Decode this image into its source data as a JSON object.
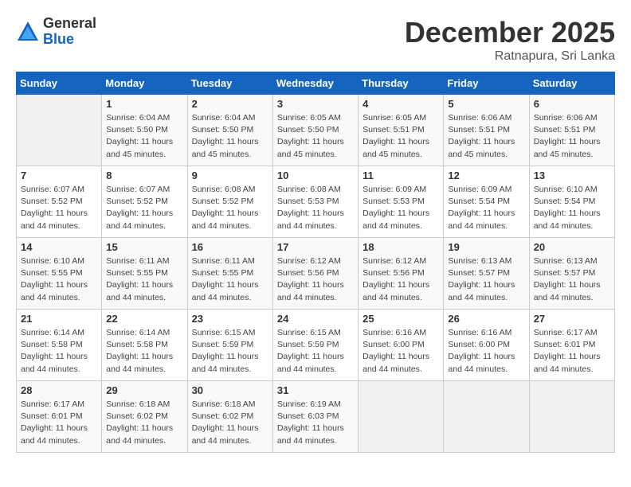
{
  "header": {
    "logo_general": "General",
    "logo_blue": "Blue",
    "title": "December 2025",
    "location": "Ratnapura, Sri Lanka"
  },
  "weekdays": [
    "Sunday",
    "Monday",
    "Tuesday",
    "Wednesday",
    "Thursday",
    "Friday",
    "Saturday"
  ],
  "weeks": [
    [
      {
        "day": "",
        "info": ""
      },
      {
        "day": "1",
        "info": "Sunrise: 6:04 AM\nSunset: 5:50 PM\nDaylight: 11 hours\nand 45 minutes."
      },
      {
        "day": "2",
        "info": "Sunrise: 6:04 AM\nSunset: 5:50 PM\nDaylight: 11 hours\nand 45 minutes."
      },
      {
        "day": "3",
        "info": "Sunrise: 6:05 AM\nSunset: 5:50 PM\nDaylight: 11 hours\nand 45 minutes."
      },
      {
        "day": "4",
        "info": "Sunrise: 6:05 AM\nSunset: 5:51 PM\nDaylight: 11 hours\nand 45 minutes."
      },
      {
        "day": "5",
        "info": "Sunrise: 6:06 AM\nSunset: 5:51 PM\nDaylight: 11 hours\nand 45 minutes."
      },
      {
        "day": "6",
        "info": "Sunrise: 6:06 AM\nSunset: 5:51 PM\nDaylight: 11 hours\nand 45 minutes."
      }
    ],
    [
      {
        "day": "7",
        "info": "Sunrise: 6:07 AM\nSunset: 5:52 PM\nDaylight: 11 hours\nand 44 minutes."
      },
      {
        "day": "8",
        "info": "Sunrise: 6:07 AM\nSunset: 5:52 PM\nDaylight: 11 hours\nand 44 minutes."
      },
      {
        "day": "9",
        "info": "Sunrise: 6:08 AM\nSunset: 5:52 PM\nDaylight: 11 hours\nand 44 minutes."
      },
      {
        "day": "10",
        "info": "Sunrise: 6:08 AM\nSunset: 5:53 PM\nDaylight: 11 hours\nand 44 minutes."
      },
      {
        "day": "11",
        "info": "Sunrise: 6:09 AM\nSunset: 5:53 PM\nDaylight: 11 hours\nand 44 minutes."
      },
      {
        "day": "12",
        "info": "Sunrise: 6:09 AM\nSunset: 5:54 PM\nDaylight: 11 hours\nand 44 minutes."
      },
      {
        "day": "13",
        "info": "Sunrise: 6:10 AM\nSunset: 5:54 PM\nDaylight: 11 hours\nand 44 minutes."
      }
    ],
    [
      {
        "day": "14",
        "info": "Sunrise: 6:10 AM\nSunset: 5:55 PM\nDaylight: 11 hours\nand 44 minutes."
      },
      {
        "day": "15",
        "info": "Sunrise: 6:11 AM\nSunset: 5:55 PM\nDaylight: 11 hours\nand 44 minutes."
      },
      {
        "day": "16",
        "info": "Sunrise: 6:11 AM\nSunset: 5:55 PM\nDaylight: 11 hours\nand 44 minutes."
      },
      {
        "day": "17",
        "info": "Sunrise: 6:12 AM\nSunset: 5:56 PM\nDaylight: 11 hours\nand 44 minutes."
      },
      {
        "day": "18",
        "info": "Sunrise: 6:12 AM\nSunset: 5:56 PM\nDaylight: 11 hours\nand 44 minutes."
      },
      {
        "day": "19",
        "info": "Sunrise: 6:13 AM\nSunset: 5:57 PM\nDaylight: 11 hours\nand 44 minutes."
      },
      {
        "day": "20",
        "info": "Sunrise: 6:13 AM\nSunset: 5:57 PM\nDaylight: 11 hours\nand 44 minutes."
      }
    ],
    [
      {
        "day": "21",
        "info": "Sunrise: 6:14 AM\nSunset: 5:58 PM\nDaylight: 11 hours\nand 44 minutes."
      },
      {
        "day": "22",
        "info": "Sunrise: 6:14 AM\nSunset: 5:58 PM\nDaylight: 11 hours\nand 44 minutes."
      },
      {
        "day": "23",
        "info": "Sunrise: 6:15 AM\nSunset: 5:59 PM\nDaylight: 11 hours\nand 44 minutes."
      },
      {
        "day": "24",
        "info": "Sunrise: 6:15 AM\nSunset: 5:59 PM\nDaylight: 11 hours\nand 44 minutes."
      },
      {
        "day": "25",
        "info": "Sunrise: 6:16 AM\nSunset: 6:00 PM\nDaylight: 11 hours\nand 44 minutes."
      },
      {
        "day": "26",
        "info": "Sunrise: 6:16 AM\nSunset: 6:00 PM\nDaylight: 11 hours\nand 44 minutes."
      },
      {
        "day": "27",
        "info": "Sunrise: 6:17 AM\nSunset: 6:01 PM\nDaylight: 11 hours\nand 44 minutes."
      }
    ],
    [
      {
        "day": "28",
        "info": "Sunrise: 6:17 AM\nSunset: 6:01 PM\nDaylight: 11 hours\nand 44 minutes."
      },
      {
        "day": "29",
        "info": "Sunrise: 6:18 AM\nSunset: 6:02 PM\nDaylight: 11 hours\nand 44 minutes."
      },
      {
        "day": "30",
        "info": "Sunrise: 6:18 AM\nSunset: 6:02 PM\nDaylight: 11 hours\nand 44 minutes."
      },
      {
        "day": "31",
        "info": "Sunrise: 6:19 AM\nSunset: 6:03 PM\nDaylight: 11 hours\nand 44 minutes."
      },
      {
        "day": "",
        "info": ""
      },
      {
        "day": "",
        "info": ""
      },
      {
        "day": "",
        "info": ""
      }
    ]
  ]
}
